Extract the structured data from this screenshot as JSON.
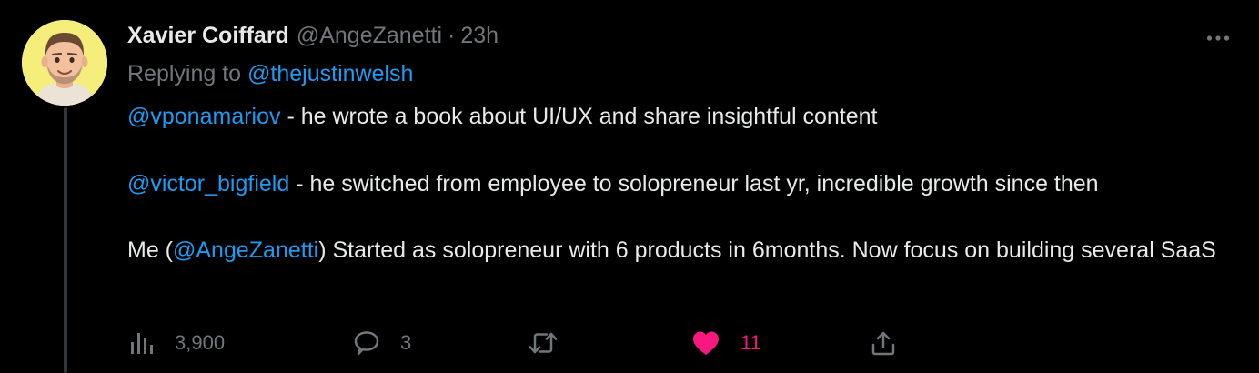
{
  "tweet": {
    "author_name": "Xavier Coiffard",
    "author_handle": "@AngeZanetti",
    "separator": "·",
    "timestamp": "23h",
    "replying_prefix": "Replying to",
    "replying_to": "@thejustinwelsh",
    "paragraphs": [
      {
        "mention": "@vponamariov",
        "text": " - he wrote a book about UI/UX and share insightful content"
      },
      {
        "mention": "@victor_bigfield",
        "text": " - he switched from employee to solopreneur last yr, incredible growth since then"
      },
      {
        "prefix": "Me (",
        "mention": "@AngeZanetti",
        "text": ") Started as solopreneur with 6 products in 6months. Now focus on building several SaaS"
      }
    ],
    "stats": {
      "views": "3,900",
      "replies": "3",
      "retweets": "",
      "likes": "11"
    }
  },
  "icons": {
    "more": "more-horizontal-icon",
    "views": "analytics-icon",
    "reply": "reply-icon",
    "retweet": "retweet-icon",
    "like": "heart-filled-icon",
    "share": "share-icon"
  },
  "colors": {
    "background": "#000000",
    "text": "#e7e9ea",
    "muted": "#71767b",
    "link": "#1d9bf0",
    "like": "#f91880",
    "thread_line": "#333639"
  }
}
